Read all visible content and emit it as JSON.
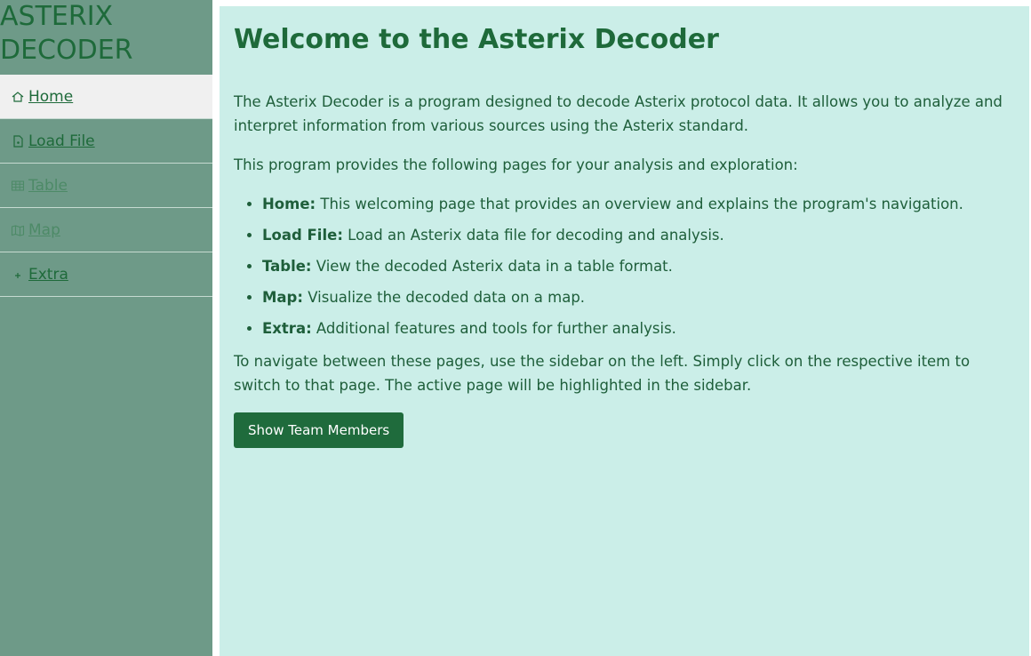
{
  "app": {
    "title_line1": "ASTERIX",
    "title_line2": "DECODER"
  },
  "sidebar": {
    "items": [
      {
        "label": " Home",
        "icon": "home-icon",
        "state": "active"
      },
      {
        "label": " Load File",
        "icon": "file-icon",
        "state": "enabled"
      },
      {
        "label": " Table",
        "icon": "table-icon",
        "state": "disabled"
      },
      {
        "label": " Map",
        "icon": "map-icon",
        "state": "disabled"
      },
      {
        "label": " Extra",
        "icon": "plus-icon",
        "state": "enabled"
      }
    ]
  },
  "main": {
    "title": "Welcome to the Asterix Decoder",
    "intro": "The Asterix Decoder is a program designed to decode Asterix protocol data. It allows you to analyze and interpret information from various sources using the Asterix standard.",
    "pages_intro": "This program provides the following pages for your analysis and exploration:",
    "pages": [
      {
        "name": "Home:",
        "desc": " This welcoming page that provides an overview and explains the program's navigation."
      },
      {
        "name": "Load File:",
        "desc": " Load an Asterix data file for decoding and analysis."
      },
      {
        "name": "Table:",
        "desc": " View the decoded Asterix data in a table format."
      },
      {
        "name": "Map:",
        "desc": " Visualize the decoded data on a map."
      },
      {
        "name": "Extra:",
        "desc": " Additional features and tools for further analysis."
      }
    ],
    "navigation_text": "To navigate between these pages, use the sidebar on the left. Simply click on the respective item to switch to that page. The active page will be highlighted in the sidebar.",
    "team_button_label": "Show Team Members"
  },
  "colors": {
    "sidebar_bg": "#6e9a88",
    "main_bg": "#cbeee8",
    "accent": "#1f6b3c",
    "active_item_bg": "#f0f0f0"
  }
}
